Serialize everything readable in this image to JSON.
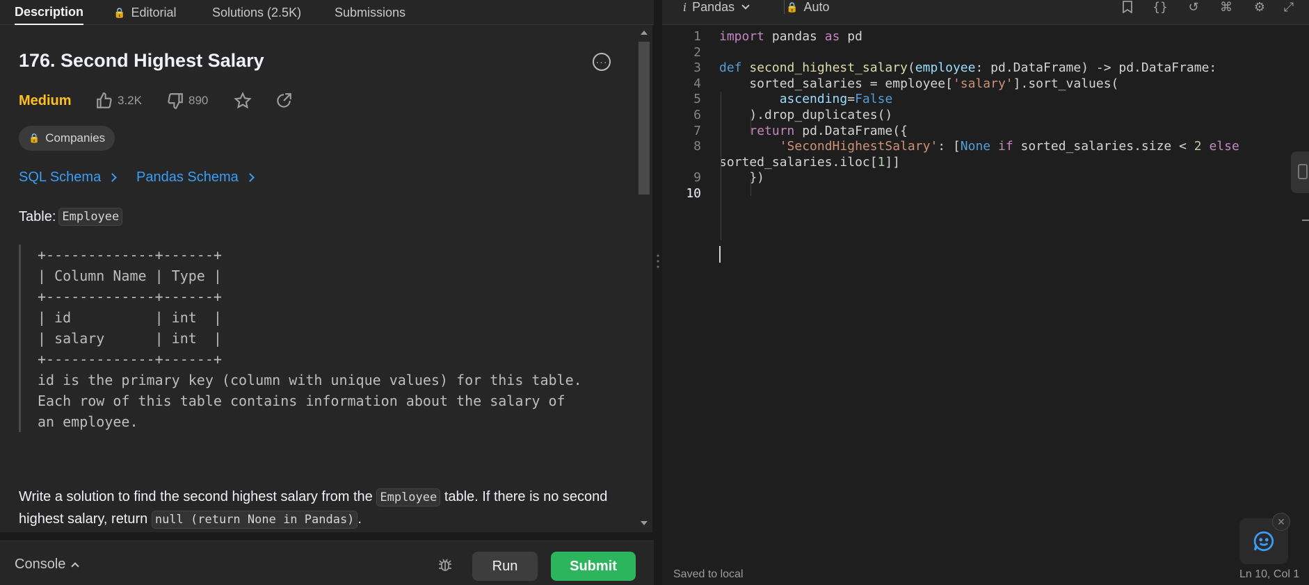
{
  "left_tabs": {
    "description": "Description",
    "editorial": "Editorial",
    "solutions": "Solutions (2.5K)",
    "submissions": "Submissions"
  },
  "problem": {
    "title": "176. Second Highest Salary",
    "difficulty": "Medium",
    "likes": "3.2K",
    "dislikes": "890",
    "companies": "Companies",
    "sql_schema": "SQL Schema",
    "pandas_schema": "Pandas Schema",
    "table_prefix": "Table:",
    "table_name": "Employee",
    "schema_text": "+-------------+------+\n| Column Name | Type |\n+-------------+------+\n| id          | int  |\n| salary      | int  |\n+-------------+------+\nid is the primary key (column with unique values) for this table.\nEach row of this table contains information about the salary of\nan employee.",
    "write_1": "Write a solution to find the second highest salary from the",
    "write_table": "Employee",
    "write_2": "table. If there is no second highest salary, return",
    "write_null": "null (return None in Pandas)",
    "write_3": "."
  },
  "console": {
    "label": "Console",
    "run": "Run",
    "submit": "Submit"
  },
  "editor_toolbar": {
    "language": "Pandas",
    "mode": "Auto"
  },
  "editor": {
    "line_numbers": [
      "1",
      "2",
      "3",
      "4",
      "5",
      "6",
      "7",
      "8",
      "9",
      "10"
    ],
    "lines": [
      [
        {
          "t": "import",
          "c": "kw"
        },
        {
          "t": " pandas ",
          "c": ""
        },
        {
          "t": "as",
          "c": "kw"
        },
        {
          "t": " pd",
          "c": ""
        }
      ],
      [],
      [
        {
          "t": "def",
          "c": "kw2"
        },
        {
          "t": " ",
          "c": ""
        },
        {
          "t": "second_highest_salary",
          "c": "fn"
        },
        {
          "t": "(",
          "c": ""
        },
        {
          "t": "employee",
          "c": "par"
        },
        {
          "t": ": pd.DataFrame) -> pd.DataFrame:",
          "c": ""
        }
      ],
      [
        {
          "t": "    sorted_salaries = employee[",
          "c": ""
        },
        {
          "t": "'salary'",
          "c": "str"
        },
        {
          "t": "].sort_values(",
          "c": ""
        }
      ],
      [
        {
          "t": "        ",
          "c": ""
        },
        {
          "t": "ascending",
          "c": "par"
        },
        {
          "t": "=",
          "c": ""
        },
        {
          "t": "False",
          "c": "kw2"
        }
      ],
      [
        {
          "t": "    ).drop_duplicates()",
          "c": ""
        }
      ],
      [
        {
          "t": "    ",
          "c": ""
        },
        {
          "t": "return",
          "c": "kw"
        },
        {
          "t": " pd.DataFrame({",
          "c": ""
        }
      ],
      [
        {
          "t": "        ",
          "c": ""
        },
        {
          "t": "'SecondHighestSalary'",
          "c": "str"
        },
        {
          "t": ": [",
          "c": ""
        },
        {
          "t": "None",
          "c": "kw2"
        },
        {
          "t": " ",
          "c": ""
        },
        {
          "t": "if",
          "c": "kw"
        },
        {
          "t": " sorted_salaries.size < ",
          "c": ""
        },
        {
          "t": "2",
          "c": "num"
        },
        {
          "t": " ",
          "c": ""
        },
        {
          "t": "else",
          "c": "kw"
        }
      ],
      [
        {
          "t": "sorted_salaries.iloc[",
          "c": ""
        },
        {
          "t": "1",
          "c": "num"
        },
        {
          "t": "]]",
          "c": ""
        }
      ],
      [
        {
          "t": "    })",
          "c": ""
        }
      ],
      []
    ]
  },
  "status": {
    "saved": "Saved to local",
    "position": "Ln 10, Col 1"
  },
  "colors": {
    "accent_green": "#2db55d",
    "medium_yellow": "#ffc01e",
    "link_blue": "#3a9df7",
    "lock_orange": "#ffa116"
  }
}
